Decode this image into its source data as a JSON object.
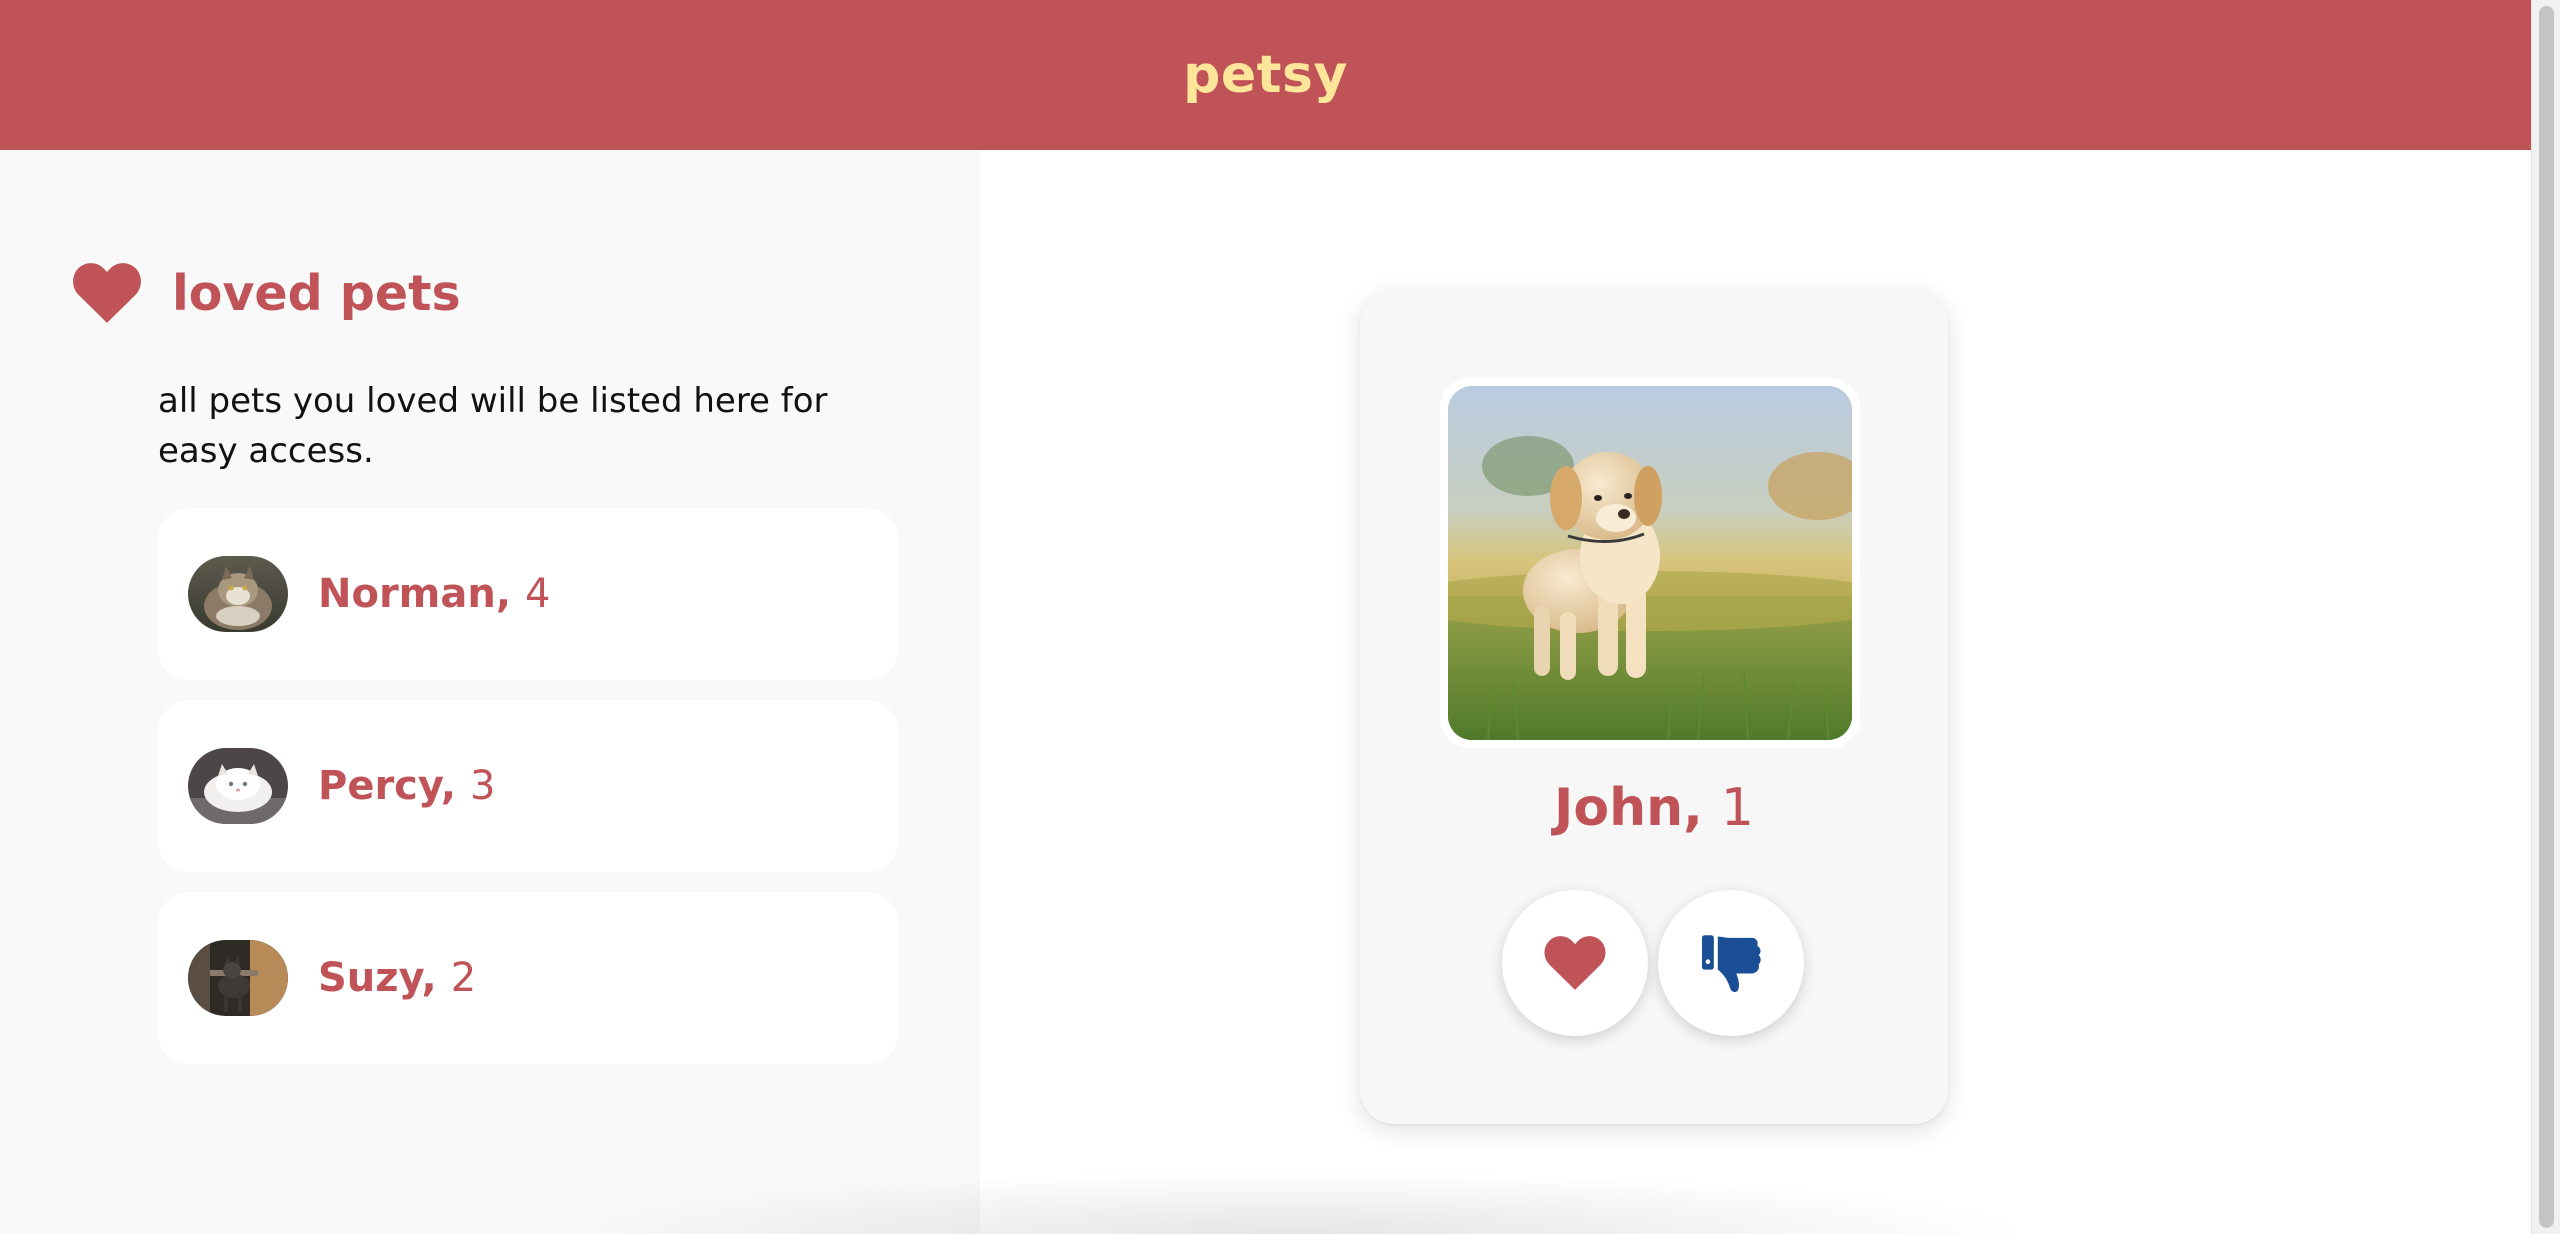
{
  "app": {
    "brand": "petsy",
    "brand_color": "#c05357",
    "brand_text_color": "#fde59a"
  },
  "sidebar": {
    "heading": "loved pets",
    "heading_icon": "heart-icon",
    "description": "all pets you loved will be listed here for easy access.",
    "pets": [
      {
        "name": "Norman,",
        "age": "4",
        "avatar": "cat-photo"
      },
      {
        "name": "Percy,",
        "age": "3",
        "avatar": "cat-photo"
      },
      {
        "name": "Suzy,",
        "age": "2",
        "avatar": "cat-photo"
      }
    ]
  },
  "card": {
    "name": "John,",
    "age": "1",
    "photo": "puppy-photo",
    "like_icon": "heart-icon",
    "dislike_icon": "thumbs-down-icon",
    "like_color": "#c05357",
    "dislike_color": "#1a4f96"
  }
}
